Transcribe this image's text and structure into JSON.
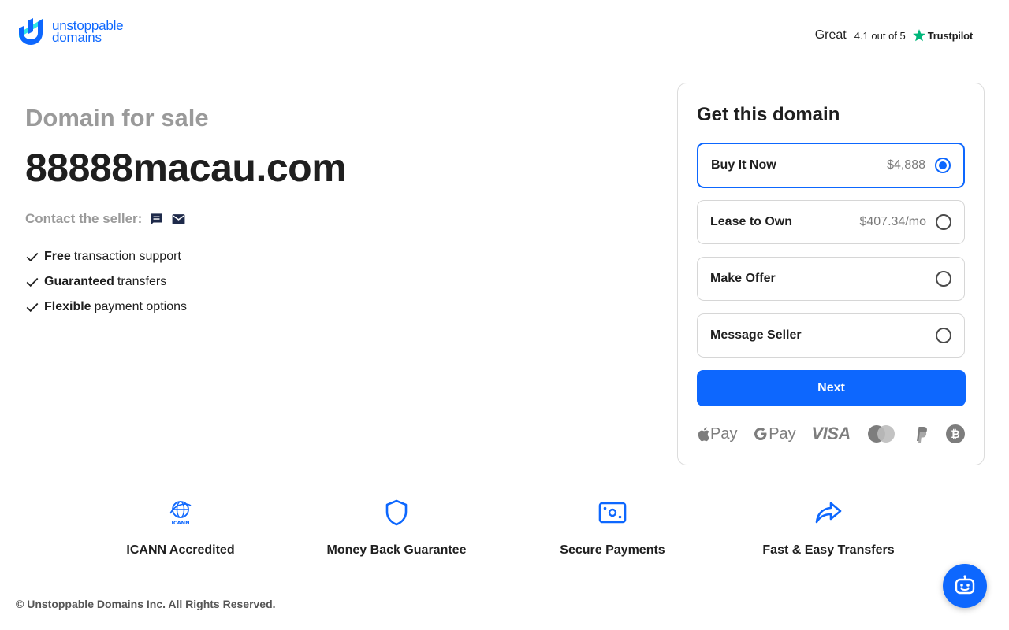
{
  "brand": {
    "line1": "unstoppable",
    "line2": "domains",
    "color": "#0d67fe"
  },
  "rating": {
    "label": "Great",
    "score": "4.1 out of 5",
    "provider": "Trustpilot",
    "star_color": "#00b67a"
  },
  "listing": {
    "kicker": "Domain for sale",
    "domain": "88888macau.com",
    "contact_label": "Contact the seller:",
    "contact_icons": [
      "chat-icon",
      "mail-icon"
    ],
    "features": [
      {
        "bold": "Free",
        "rest": "transaction support"
      },
      {
        "bold": "Guaranteed",
        "rest": "transfers"
      },
      {
        "bold": "Flexible",
        "rest": "payment options"
      }
    ]
  },
  "purchase": {
    "title": "Get this domain",
    "options": [
      {
        "label": "Buy It Now",
        "price": "$4,888",
        "selected": true
      },
      {
        "label": "Lease to Own",
        "price": "$407.34/mo",
        "selected": false
      },
      {
        "label": "Make Offer",
        "price": "",
        "selected": false
      },
      {
        "label": "Message Seller",
        "price": "",
        "selected": false
      }
    ],
    "next_label": "Next",
    "payment_methods": {
      "apple": "Pay",
      "google": "Pay",
      "visa": "VISA",
      "icons": [
        "apple-icon",
        "google-icon",
        "mastercard-icon",
        "paypal-icon",
        "bitcoin-icon"
      ]
    }
  },
  "trust_badges": [
    {
      "label": "ICANN Accredited",
      "icon": "icann-icon",
      "icon_text": "ICANN"
    },
    {
      "label": "Money Back Guarantee",
      "icon": "shield-icon"
    },
    {
      "label": "Secure Payments",
      "icon": "payment-icon"
    },
    {
      "label": "Fast & Easy Transfers",
      "icon": "share-arrow-icon"
    }
  ],
  "footer": {
    "copyright": "© Unstoppable Domains Inc. All Rights Reserved."
  },
  "colors": {
    "accent": "#0d67fe",
    "muted": "#9a9a9a",
    "text": "#1f1f1f"
  }
}
